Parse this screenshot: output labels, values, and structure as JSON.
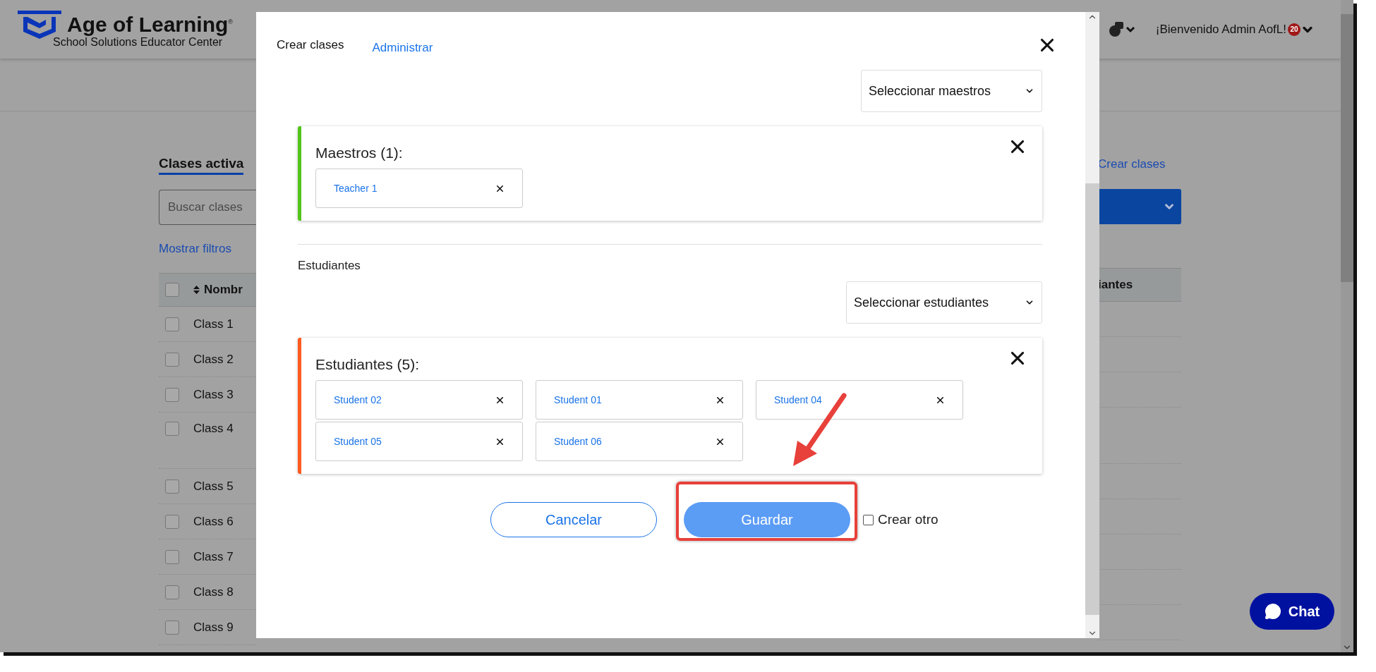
{
  "header": {
    "logo_title": "Age of Learning$^{®}$",
    "subtitle": "School Solutions Educator Center",
    "welcome": "¡Bienvenido Admin AofL!",
    "badge": "20"
  },
  "page": {
    "title": "Clases activa",
    "search": {
      "placeholder": "Buscar clases"
    },
    "filters_link": "Mostrar filtros",
    "create_link": "Crear clases",
    "table": {
      "header_checked": false,
      "columns": [
        "Nombr",
        "iantes"
      ],
      "rows": [
        {
          "name": "Class 1",
          "checked": false,
          "tall": false
        },
        {
          "name": "Class 2",
          "checked": false,
          "tall": false
        },
        {
          "name": "Class 3",
          "checked": false,
          "tall": false
        },
        {
          "name": "Class 4",
          "checked": false,
          "tall": true
        },
        {
          "name": "Class 5",
          "checked": false,
          "tall": false
        },
        {
          "name": "Class 6",
          "checked": false,
          "tall": false
        },
        {
          "name": "Class 7",
          "checked": false,
          "tall": false
        },
        {
          "name": "Class 8",
          "checked": false,
          "tall": false
        },
        {
          "name": "Class 9",
          "checked": false,
          "tall": false
        }
      ]
    }
  },
  "modal": {
    "tabs": [
      {
        "label": "Crear clases",
        "selected": true
      },
      {
        "label": "Administrar",
        "selected": false
      }
    ],
    "groups": [
      {
        "select": "Seleccionar maestros",
        "title": "Maestros (1):",
        "color": "#52c41a",
        "chips": [
          "Teacher 1"
        ]
      },
      {
        "heading": "Estudiantes",
        "select": "Seleccionar estudiantes",
        "title": "Estudiantes (5):",
        "color": "#ff5a1f",
        "chips": [
          "Student 02",
          "Student 01",
          "Student 04",
          "Student 05",
          "Student 06"
        ]
      }
    ],
    "cancel": "Cancelar",
    "save": "Guardar",
    "create_another": {
      "label": "Crear otro",
      "checked": false
    }
  },
  "chat": {
    "label": "Chat"
  }
}
